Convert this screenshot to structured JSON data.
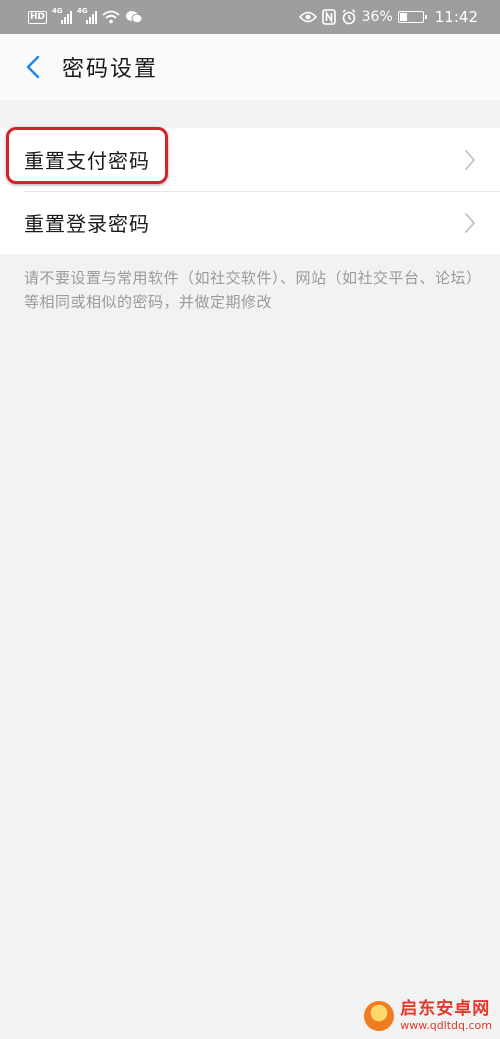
{
  "status_bar": {
    "hd": "HD",
    "signal1": "4G",
    "signal2": "4G",
    "battery": "36%",
    "battery_level": 0.36,
    "time": "11:42",
    "icons": [
      "wifi-icon",
      "wechat-icon",
      "eye-icon",
      "nfc-icon",
      "alarm-icon",
      "battery-icon"
    ]
  },
  "header": {
    "title": "密码设置",
    "back_icon": "chevron-left-icon",
    "accent": "#1e88e5"
  },
  "list": {
    "items": [
      {
        "label": "重置支付密码",
        "icon": "chevron-right-icon",
        "highlighted": true
      },
      {
        "label": "重置登录密码",
        "icon": "chevron-right-icon",
        "highlighted": false
      }
    ],
    "highlight_color": "#d2232a"
  },
  "hint": "请不要设置与常用软件（如社交软件）、网站（如社交平台、论坛）等相同或相似的密码，并做定期修改",
  "watermark": {
    "name": "启东安卓网",
    "url": "www.qdltdq.com"
  }
}
